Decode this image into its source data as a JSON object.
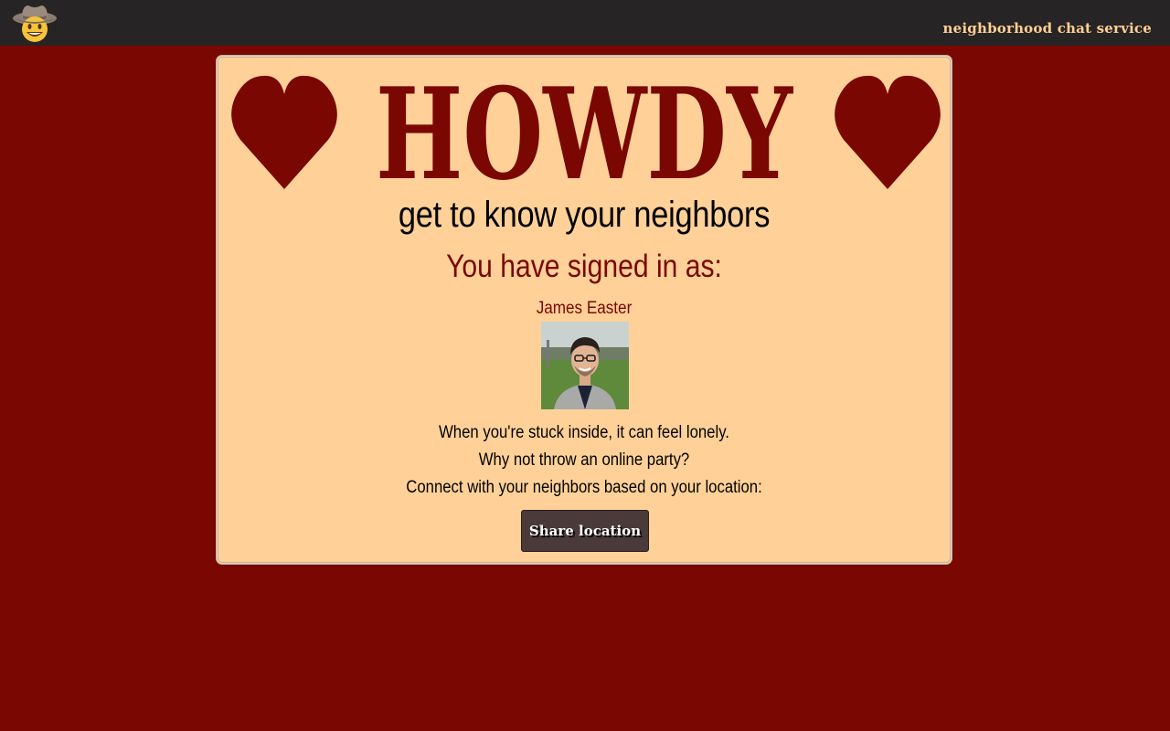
{
  "topbar": {
    "logo_icon": "cowboy-face-icon",
    "service_name": "neighborhood chat service"
  },
  "card": {
    "heading": "HOWDY",
    "heart_icon": "heart-icon",
    "tagline": "get to know your neighbors",
    "signed_in_label": "You have signed in as:",
    "user_name": "James Easter",
    "message_lines": [
      "When you're stuck inside, it can feel lonely.",
      "Why not throw an online party?",
      "Connect with your neighbors based on your location:"
    ],
    "share_button_label": "Share location"
  },
  "colors": {
    "background": "#7a0702",
    "topbar": "#262424",
    "card": "#ffd198",
    "accent": "#7a0702",
    "service_name": "#ffcf95",
    "button": "#4a3a3a"
  }
}
